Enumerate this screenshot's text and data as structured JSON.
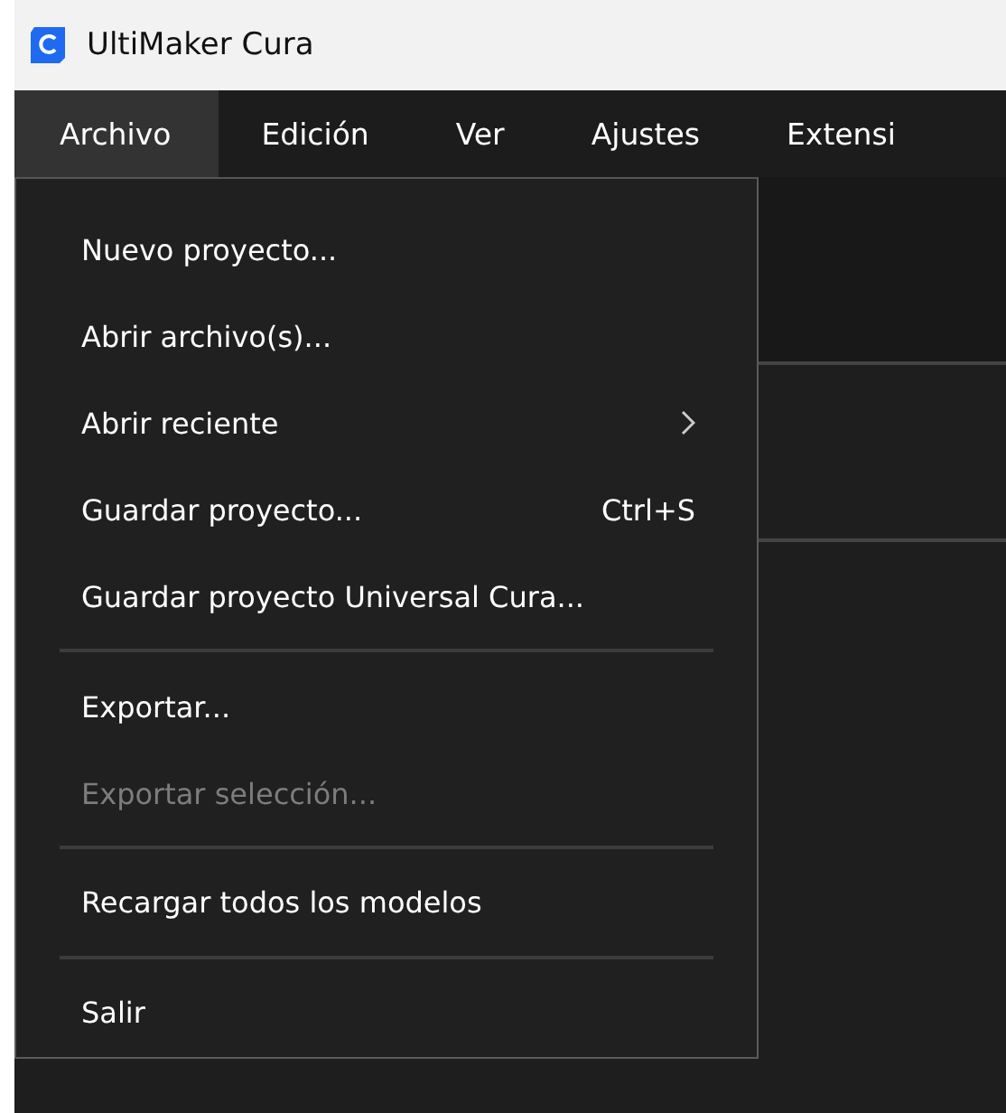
{
  "window": {
    "title": "UltiMaker Cura"
  },
  "menubar": [
    {
      "label": "Archivo",
      "selected": true
    },
    {
      "label": "Edición",
      "selected": false
    },
    {
      "label": "Ver",
      "selected": false
    },
    {
      "label": "Ajustes",
      "selected": false
    },
    {
      "label": "Extensi",
      "selected": false
    }
  ],
  "menu": [
    {
      "kind": "item",
      "label": "Nuevo proyecto...",
      "disabled": false
    },
    {
      "kind": "item",
      "label": "Abrir archivo(s)...",
      "disabled": false
    },
    {
      "kind": "item",
      "label": "Abrir reciente",
      "disabled": false,
      "submenu": true
    },
    {
      "kind": "item",
      "label": "Guardar proyecto...",
      "disabled": false,
      "shortcut": "Ctrl+S"
    },
    {
      "kind": "item",
      "label": "Guardar proyecto Universal Cura...",
      "disabled": false
    },
    {
      "kind": "separator"
    },
    {
      "kind": "item",
      "label": "Exportar...",
      "disabled": false
    },
    {
      "kind": "item",
      "label": "Exportar selección...",
      "disabled": true
    },
    {
      "kind": "separator"
    },
    {
      "kind": "item",
      "label": "Recargar todos los modelos",
      "disabled": false
    },
    {
      "kind": "separator"
    },
    {
      "kind": "item",
      "label": "Salir",
      "disabled": false
    }
  ]
}
